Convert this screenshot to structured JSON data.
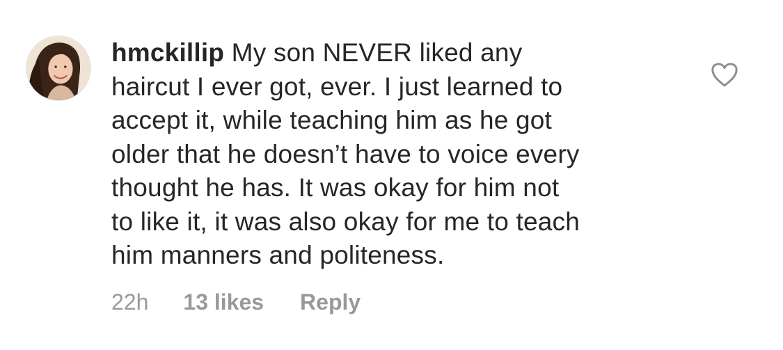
{
  "comment": {
    "username": "hmckillip",
    "text_lines": [
      "My son NEVER liked any",
      "haircut I ever got, ever. I just learned to",
      "accept it, while teaching him as he got",
      "older that he doesn’t have to voice every",
      "thought he has. It was okay for him not",
      "to like it, it was also okay for me to teach",
      "him manners and politeness."
    ],
    "timestamp": "22h",
    "likes": "13 likes",
    "reply_label": "Reply"
  },
  "icons": {
    "avatar": "profile-photo",
    "like": "heart-outline-icon"
  },
  "colors": {
    "text": "#262626",
    "meta": "#999999",
    "icon": "#8e8e8e",
    "background": "#ffffff"
  }
}
